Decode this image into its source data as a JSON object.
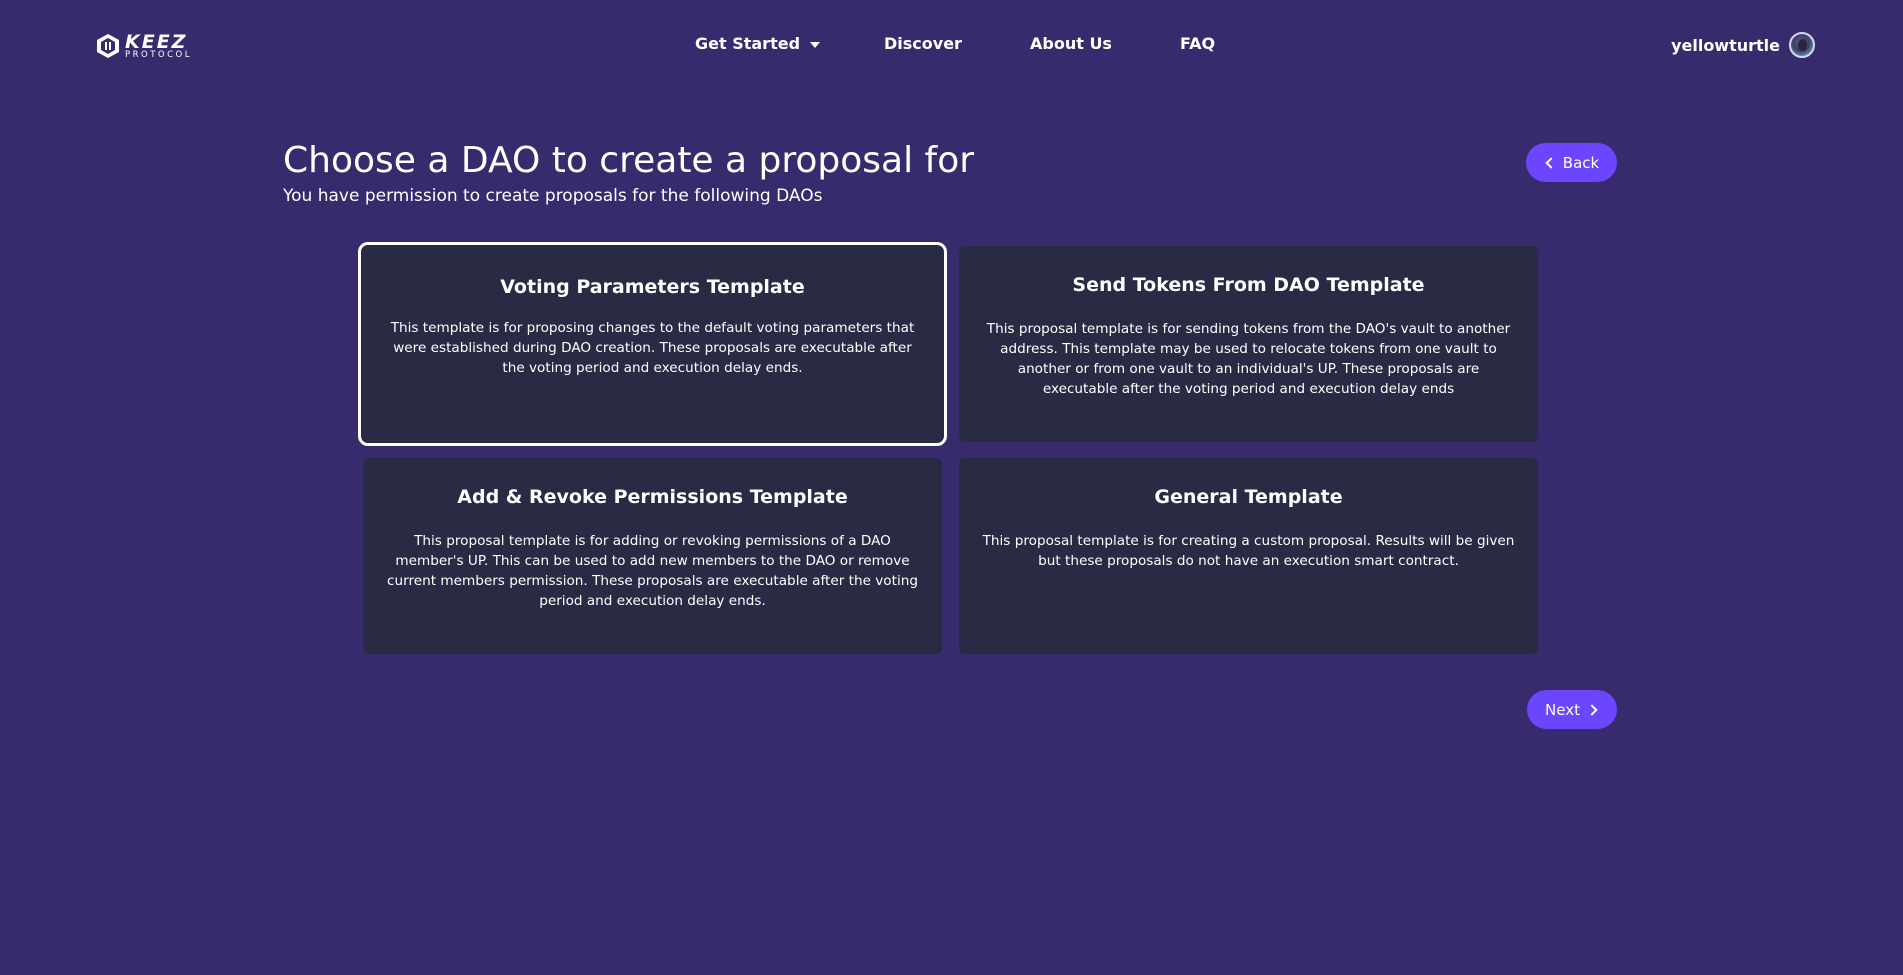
{
  "header": {
    "logo": {
      "main": "KEEZ",
      "sub": "PROTOCOL"
    },
    "nav": [
      {
        "label": "Get Started",
        "has_dropdown": true
      },
      {
        "label": "Discover"
      },
      {
        "label": "About Us"
      },
      {
        "label": "FAQ"
      }
    ],
    "user": {
      "username": "yellowturtle"
    }
  },
  "page": {
    "title": "Choose a DAO to create a proposal for",
    "subtitle": "You have permission to create proposals for the following DAOs",
    "back_label": "Back",
    "next_label": "Next"
  },
  "templates": [
    {
      "title": "Voting Parameters Template",
      "description": "This template is for proposing changes to the default voting parameters that were established during DAO creation. These proposals are executable after the voting period and execution delay ends.",
      "selected": true
    },
    {
      "title": "Send Tokens From DAO Template",
      "description": "This proposal template is for sending tokens from the DAO's vault to another address. This template may be used to relocate tokens from one vault to another or from one vault to an individual's UP. These proposals are executable after the voting period and execution delay ends",
      "selected": false
    },
    {
      "title": "Add & Revoke Permissions Template",
      "description": "This proposal template is for adding or revoking permissions of a DAO member's UP. This can be used to add new members to the DAO or remove current members permission. These proposals are executable after the voting period and execution delay ends.",
      "selected": false
    },
    {
      "title": "General Template",
      "description": "This proposal template is for creating a custom proposal. Results will be given but these proposals do not have an execution smart contract.",
      "selected": false
    }
  ],
  "colors": {
    "background": "#372b6e",
    "card": "#292a44",
    "accent": "#6b46fe",
    "text": "#ffffff"
  }
}
